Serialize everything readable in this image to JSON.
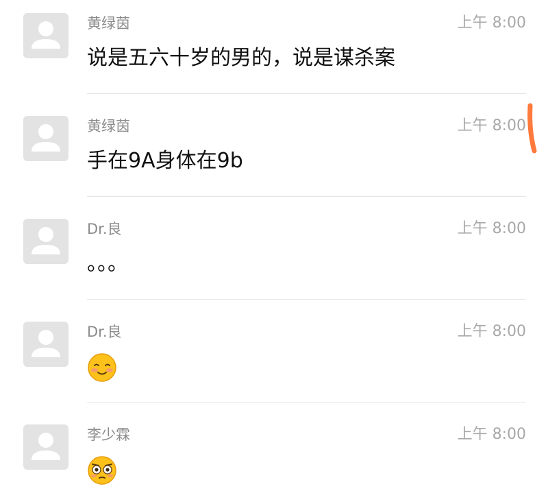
{
  "messages": [
    {
      "sender": "黄绿茵",
      "time": "上午 8:00",
      "text": "说是五六十岁的男的，说是谋杀案"
    },
    {
      "sender": "黄绿茵",
      "time": "上午 8:00",
      "text": "手在9A身体在9b"
    },
    {
      "sender": "Dr.良",
      "time": "上午 8:00",
      "text": "。。。"
    },
    {
      "sender": "Dr.良",
      "time": "上午 8:00",
      "emoji": "blushing-smile-emoji"
    },
    {
      "sender": "李少霖",
      "time": "上午 8:00",
      "emoji": "flushed-face-emoji"
    }
  ],
  "colors": {
    "avatar_bg": "#e3e3e3",
    "avatar_fg": "#ffffff",
    "sender": "#8c8c8c",
    "time": "#a8a8a8",
    "text": "#111111",
    "divider": "#e6e6e6",
    "scroll_mark": "#ff7a3c"
  }
}
